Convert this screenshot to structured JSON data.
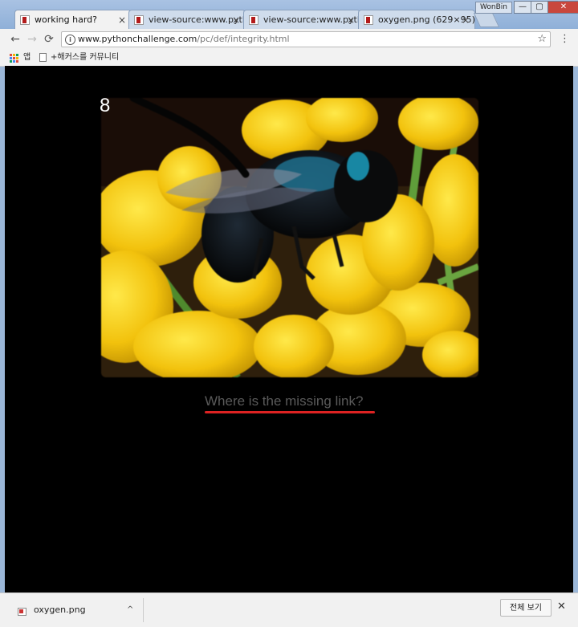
{
  "tabs": [
    {
      "label": "working hard?",
      "active": true
    },
    {
      "label": "view-source:www.pytho",
      "active": false
    },
    {
      "label": "view-source:www.pytho",
      "active": false
    },
    {
      "label": "oxygen.png (629×95)",
      "active": false
    }
  ],
  "user_badge": "WonBin",
  "window_controls": {
    "minimize": "—",
    "maximize": "▢",
    "close": "✕"
  },
  "toolbar": {
    "back": "←",
    "forward": "→",
    "reload": "⟳",
    "menu": "⋮"
  },
  "omnibox": {
    "host": "www.pythonchallenge.com",
    "path": "/pc/def/integrity.html",
    "info_icon": "i",
    "star_icon": "☆"
  },
  "bookmarks": {
    "apps_label": "앱",
    "items": [
      {
        "label": "+해커스를 커뮤니티"
      }
    ]
  },
  "content": {
    "puzzle_number": "8",
    "caption": "Where is the missing link?",
    "colors": {
      "background": "#000000",
      "caption": "#5a5a5a",
      "underline": "#dd2222"
    }
  },
  "download_shelf": {
    "file_name": "oxygen.png",
    "chevron": "^",
    "show_all": "전체 보기",
    "close": "✕"
  }
}
